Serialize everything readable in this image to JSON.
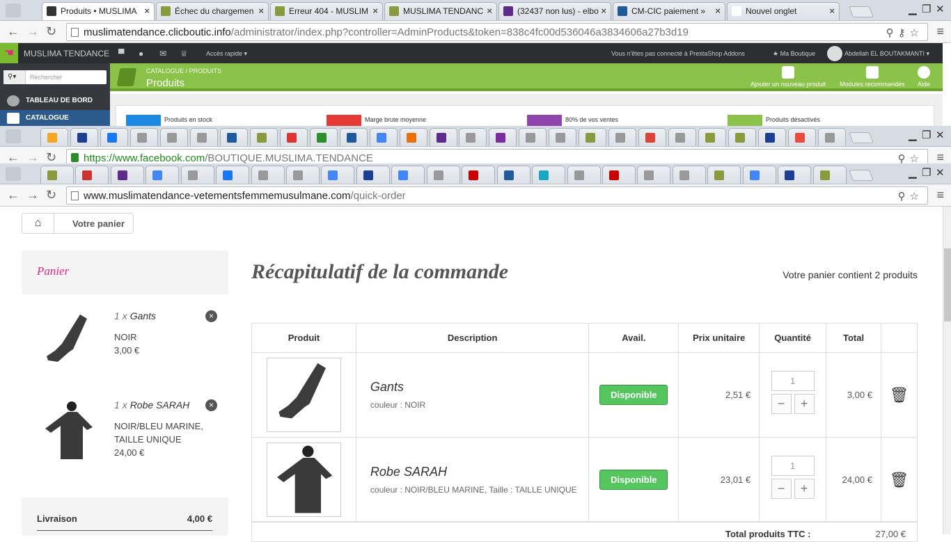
{
  "win1": {
    "tabs": [
      {
        "label": "Produits • MUSLIMA",
        "active": true,
        "fav": "#333"
      },
      {
        "label": "Échec du chargemen",
        "fav": "#8a9a3c"
      },
      {
        "label": "Erreur 404 - MUSLIM",
        "fav": "#8a9a3c"
      },
      {
        "label": "MUSLIMA TENDANC",
        "fav": "#8a9a3c"
      },
      {
        "label": "(32437 non lus) - elbo",
        "fav": "#5e2a8c"
      },
      {
        "label": "CM-CIC paiement » ",
        "fav": "#1e5a9c"
      },
      {
        "label": "Nouvel onglet",
        "fav": "#ffffff"
      }
    ],
    "url_host": "muslimatendance.clicboutic.info",
    "url_path": "/administrator/index.php?controller=AdminProducts&token=838c4fc00d536046a3834606a27b3d19"
  },
  "admin": {
    "shop": "MUSLIMA TENDANCE",
    "quick": "Accès rapide ▾",
    "addons": "Vous n'êtes pas connecté à PrestaShop Addons",
    "myshop": "★ Ma Boutique",
    "user": "Abdellah EL BOUTAKMANTI ▾",
    "search_placeholder": "Rechercher",
    "side": [
      "TABLEAU DE BORD",
      "CATALOGUE"
    ],
    "breadcrumb": "CATALOGUE  /  PRODUITS",
    "title": "Produits",
    "actions": [
      "Ajouter un nouveau produit",
      "Modules recommandés",
      "Aide"
    ],
    "kpis": [
      "Produits en stock",
      "Marge brute moyenne",
      "80% de vos ventes",
      "Produits désactivés"
    ]
  },
  "win2": {
    "url_host": "https://www.facebook.com",
    "url_path": "/BOUTIQUE.MUSLIMA.TENDANCE"
  },
  "win3": {
    "url_host": "www.muslimatendance-vetementsfemmemusulmane.com",
    "url_path": "/quick-order"
  },
  "shop": {
    "breadcrumb": "Votre panier",
    "cart_title": "Panier",
    "cart_items": [
      {
        "qty": "1",
        "mult": "x",
        "name": "Gants",
        "attr": "NOIR",
        "price": "3,00 €"
      },
      {
        "qty": "1",
        "mult": "x",
        "name": "Robe SARAH",
        "attr": "NOIR/BLEU MARINE, TAILLE UNIQUE",
        "price": "24,00 €"
      }
    ],
    "shipping_label": "Livraison",
    "shipping_value": "4,00 €",
    "heading": "Récapitulatif de la commande",
    "count": "Votre panier contient 2 produits",
    "cols": [
      "Produit",
      "Description",
      "Avail.",
      "Prix unitaire",
      "Quantité",
      "Total"
    ],
    "rows": [
      {
        "name": "Gants",
        "attr": "couleur : NOIR",
        "avail": "Disponible",
        "unit": "2,51 €",
        "qty": "1",
        "total": "3,00 €"
      },
      {
        "name": "Robe SARAH",
        "attr": "couleur : NOIR/BLEU MARINE, Taille : TAILLE UNIQUE",
        "avail": "Disponible",
        "unit": "23,01 €",
        "qty": "1",
        "total": "24,00 €"
      }
    ],
    "total_label": "Total produits TTC :",
    "total_value": "27,00 €"
  }
}
